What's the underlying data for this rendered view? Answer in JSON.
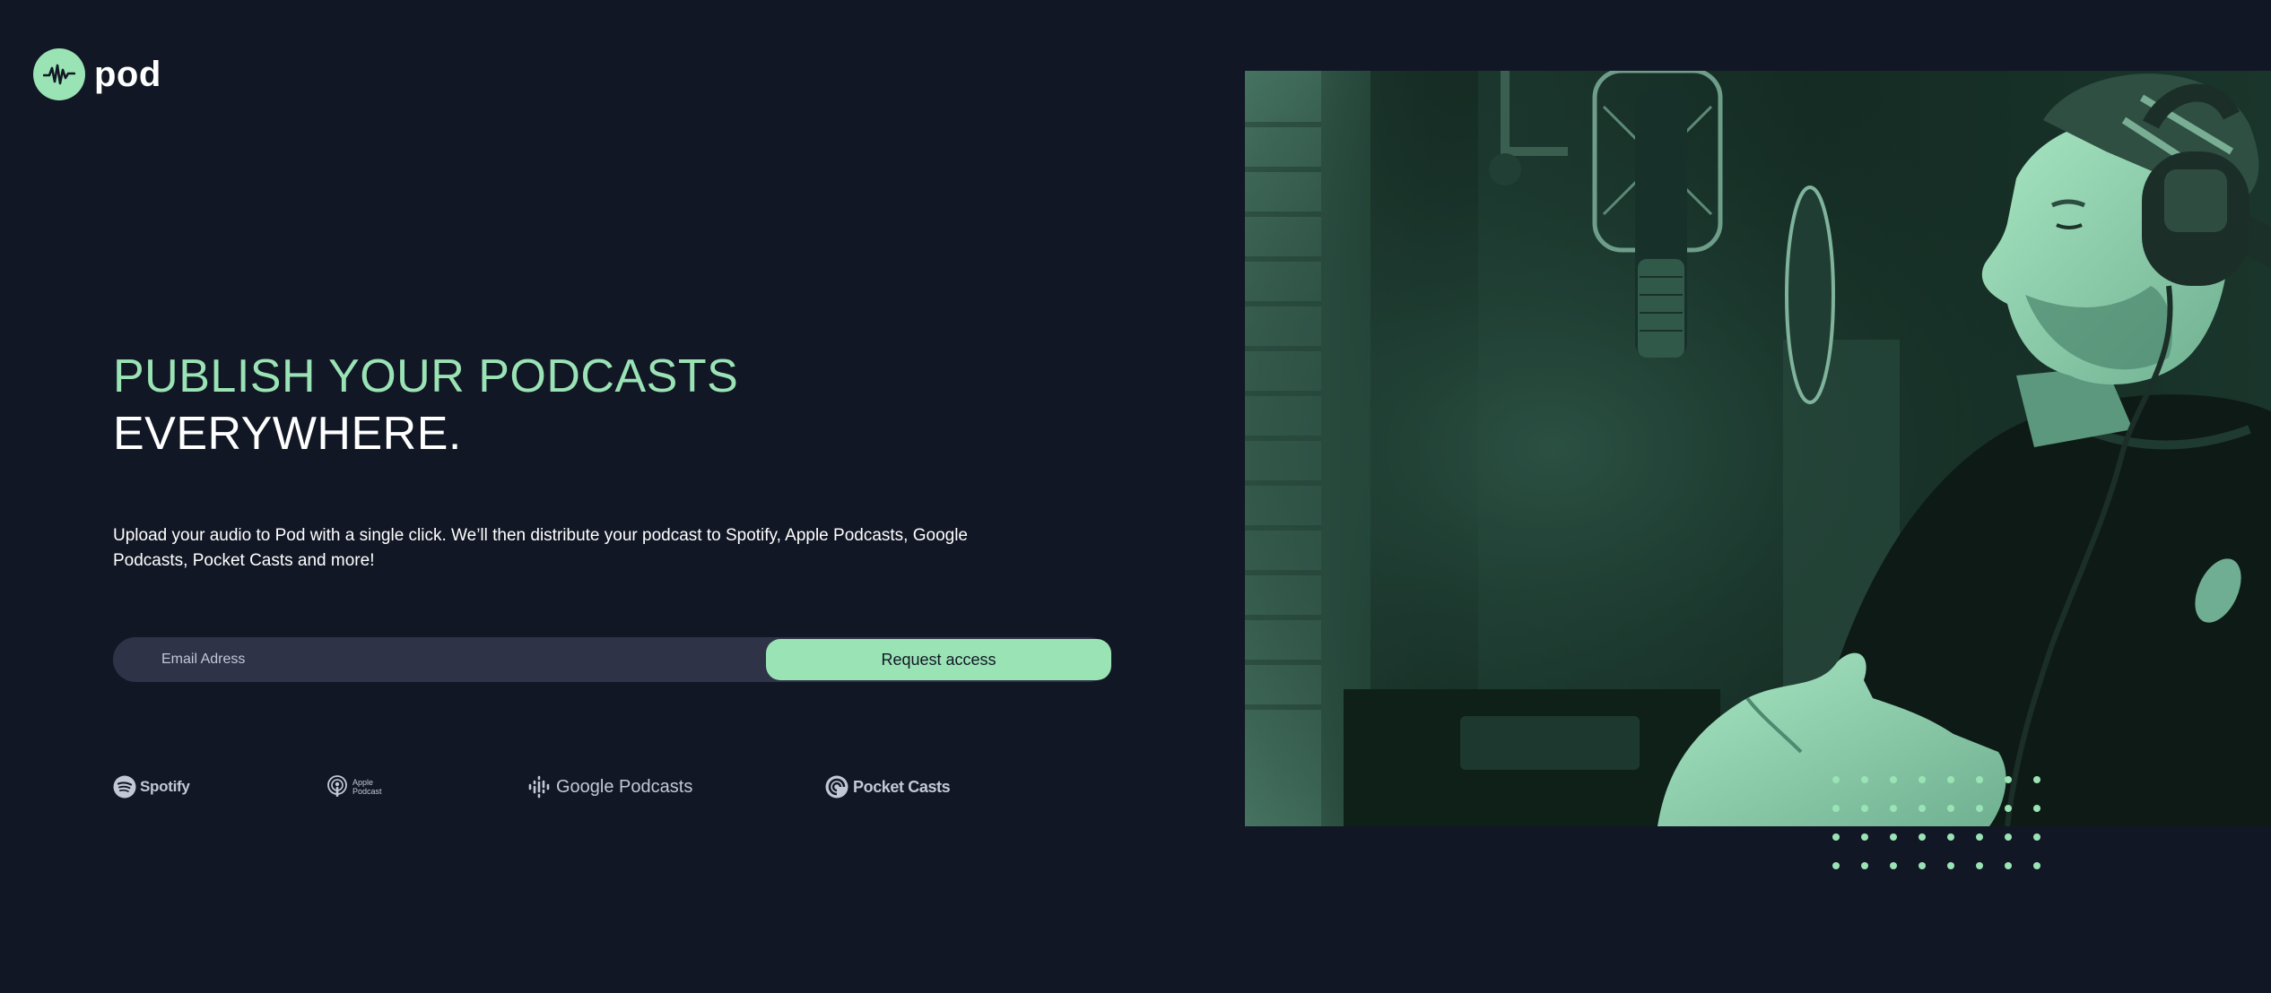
{
  "brand": {
    "name": "pod",
    "logo_icon": "waveform-icon",
    "accent_color": "#9ae3b5",
    "background_color": "#121725"
  },
  "hero": {
    "headline_accent": "PUBLISH YOUR PODCASTS",
    "headline_rest": "EVERYWHERE.",
    "description": "Upload your audio to Pod with a single click. We’ll then distribute your podcast to Spotify, Apple Podcasts, Google Podcasts, Pocket Casts and more!",
    "image_icon": "podcaster-recording-photo"
  },
  "form": {
    "email_placeholder": "Email Adress",
    "email_value": "",
    "submit_label": "Request access"
  },
  "platforms": [
    {
      "name": "Spotify",
      "icon": "spotify-icon"
    },
    {
      "name": "Apple Podcast",
      "line1": "Apple",
      "line2": "Podcast",
      "icon": "apple-podcasts-icon"
    },
    {
      "name": "Google Podcasts",
      "icon": "google-podcasts-icon"
    },
    {
      "name": "Pocket Casts",
      "icon": "pocket-casts-icon"
    }
  ]
}
